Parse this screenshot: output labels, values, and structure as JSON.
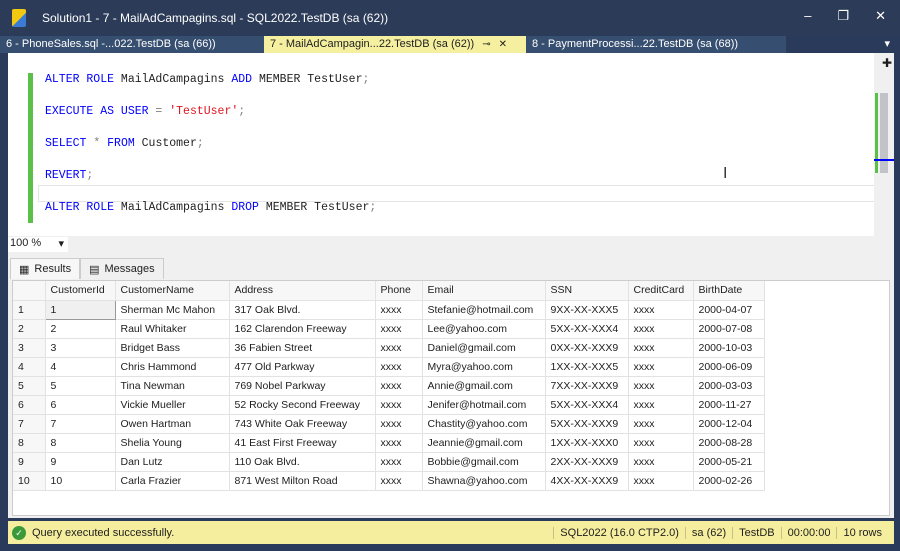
{
  "window": {
    "title": "Solution1 - 7 - MailAdCampagins.sql - SQL2022.TestDB (sa (62))",
    "minimize": "–",
    "maximize": "❐",
    "close": "✕"
  },
  "tabs": [
    {
      "label": "6 - PhoneSales.sql -...022.TestDB (sa (66))"
    },
    {
      "label": "7 - MailAdCampagin...22.TestDB (sa (62))",
      "pin": "⊸",
      "close": "✕"
    },
    {
      "label": "8 - PaymentProcessi...22.TestDB (sa (68))"
    }
  ],
  "editor": {
    "lines": [
      [
        {
          "t": "ALTER ROLE",
          "c": "kw"
        },
        {
          "t": " MailAdCampagins ",
          "c": "tx"
        },
        {
          "t": "ADD",
          "c": "kw"
        },
        {
          "t": " MEMBER TestUser",
          "c": "tx"
        },
        {
          "t": ";",
          "c": "gr"
        }
      ],
      [
        {
          "t": "EXECUTE AS USER",
          "c": "kw"
        },
        {
          "t": " = ",
          "c": "gr"
        },
        {
          "t": "'TestUser'",
          "c": "str"
        },
        {
          "t": ";",
          "c": "gr"
        }
      ],
      [
        {
          "t": "SELECT",
          "c": "kw"
        },
        {
          "t": " * ",
          "c": "gr"
        },
        {
          "t": "FROM",
          "c": "kw"
        },
        {
          "t": " Customer",
          "c": "tx"
        },
        {
          "t": ";",
          "c": "gr"
        }
      ],
      [
        {
          "t": "REVERT",
          "c": "kw"
        },
        {
          "t": ";",
          "c": "gr"
        }
      ],
      [
        {
          "t": "ALTER ROLE",
          "c": "kw"
        },
        {
          "t": " MailAdCampagins ",
          "c": "tx"
        },
        {
          "t": "DROP",
          "c": "kw"
        },
        {
          "t": " MEMBER TestUser",
          "c": "tx"
        },
        {
          "t": ";",
          "c": "gr"
        }
      ]
    ]
  },
  "zoom": {
    "value": "100 %"
  },
  "results_tabs": {
    "results": "Results",
    "messages": "Messages"
  },
  "grid": {
    "columns": [
      "CustomerId",
      "CustomerName",
      "Address",
      "Phone",
      "Email",
      "SSN",
      "CreditCard",
      "BirthDate"
    ],
    "rows": [
      [
        "1",
        "Sherman Mc Mahon",
        "317 Oak Blvd.",
        "xxxx",
        "Stefanie@hotmail.com",
        "9XX-XX-XXX5",
        "xxxx",
        "2000-04-07"
      ],
      [
        "2",
        "Raul Whitaker",
        "162 Clarendon Freeway",
        "xxxx",
        "Lee@yahoo.com",
        "5XX-XX-XXX4",
        "xxxx",
        "2000-07-08"
      ],
      [
        "3",
        "Bridget Bass",
        "36 Fabien Street",
        "xxxx",
        "Daniel@gmail.com",
        "0XX-XX-XXX9",
        "xxxx",
        "2000-10-03"
      ],
      [
        "4",
        "Chris Hammond",
        "477 Old Parkway",
        "xxxx",
        "Myra@yahoo.com",
        "1XX-XX-XXX5",
        "xxxx",
        "2000-06-09"
      ],
      [
        "5",
        "Tina Newman",
        "769 Nobel Parkway",
        "xxxx",
        "Annie@gmail.com",
        "7XX-XX-XXX9",
        "xxxx",
        "2000-03-03"
      ],
      [
        "6",
        "Vickie Mueller",
        "52 Rocky Second Freeway",
        "xxxx",
        "Jenifer@hotmail.com",
        "5XX-XX-XXX4",
        "xxxx",
        "2000-11-27"
      ],
      [
        "7",
        "Owen Hartman",
        "743 White Oak Freeway",
        "xxxx",
        "Chastity@yahoo.com",
        "5XX-XX-XXX9",
        "xxxx",
        "2000-12-04"
      ],
      [
        "8",
        "Shelia Young",
        "41 East First Freeway",
        "xxxx",
        "Jeannie@gmail.com",
        "1XX-XX-XXX0",
        "xxxx",
        "2000-08-28"
      ],
      [
        "9",
        "Dan Lutz",
        "110 Oak Blvd.",
        "xxxx",
        "Bobbie@gmail.com",
        "2XX-XX-XXX9",
        "xxxx",
        "2000-05-21"
      ],
      [
        "10",
        "Carla Frazier",
        "871 West Milton Road",
        "xxxx",
        "Shawna@yahoo.com",
        "4XX-XX-XXX9",
        "xxxx",
        "2000-02-26"
      ]
    ]
  },
  "status": {
    "message": "Query executed successfully.",
    "server": "SQL2022 (16.0 CTP2.0)",
    "user": "sa (62)",
    "database": "TestDB",
    "elapsed": "00:00:00",
    "rows": "10 rows"
  }
}
